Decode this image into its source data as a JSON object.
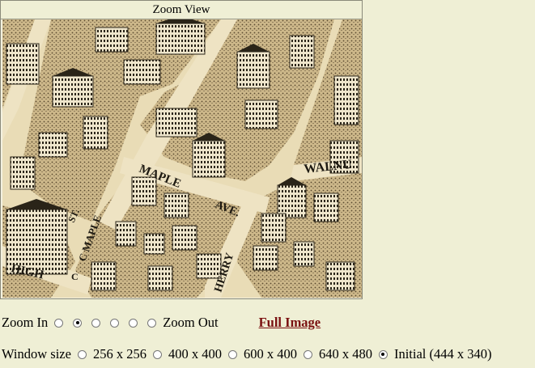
{
  "viewer": {
    "title": "Zoom View",
    "map_labels": {
      "maple_street": "MAPLE",
      "avenue_abbrev": "AVE.",
      "walnut_partial": "WALNU",
      "st": "ST.",
      "cmaple": "C MAPLE",
      "high": "HIGH",
      "herry_partial": "HERRY",
      "c_apos": "C"
    }
  },
  "zoom": {
    "zoom_in_label": "Zoom In",
    "zoom_out_label": "Zoom Out",
    "levels": 6,
    "selected_index": 1,
    "full_image_label": "Full Image"
  },
  "window_size": {
    "label": "Window size",
    "options": [
      "256 x 256",
      "400 x 400",
      "600 x 400",
      "640 x 480",
      "Initial (444 x 340)"
    ],
    "selected_index": 4
  },
  "colors": {
    "page_bg": "#efefd5",
    "map_paper": "#e9dcb6",
    "ink": "#2a2418",
    "link": "#7a1010"
  }
}
